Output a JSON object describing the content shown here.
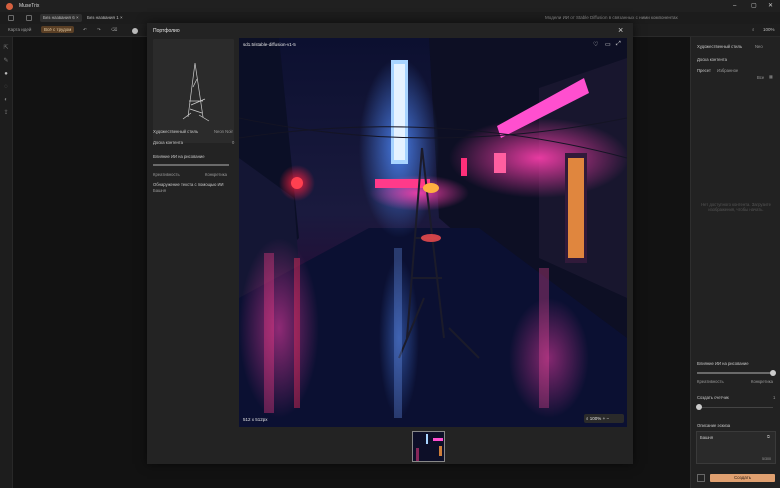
{
  "app": {
    "title": "MuseTrix"
  },
  "tabs": [
    {
      "label": "Без названия 6"
    },
    {
      "label": "Без названия 1"
    }
  ],
  "tab_right_text": "Модели ИИ от Stable Diffusion в связанных с ними компонентах",
  "toolbar": {
    "label_left": "Карта идей",
    "chip": "Всё с трудом",
    "zoom": "100%"
  },
  "modal": {
    "title": "Портфолио",
    "style_label": "Художественный стиль",
    "style_value": "Neon Noir",
    "board_label": "Доска контента",
    "board_value": "0",
    "influence_label": "Влияние ИИ на рисование",
    "slider_left": "Креативность",
    "slider_right": "Конкретика",
    "detect_label": "Обнаружение текста с помощью ИИ",
    "detect_value": "Башня",
    "image_caption": "sd1.5/stable-diffusion-v1-5",
    "image_dims": "512 x 512px",
    "image_zoom": "100%"
  },
  "right_panel": {
    "style_label": "Художественный стиль",
    "style_value": "Neo",
    "board_label": "Доска контента",
    "preset_label": "Пресет",
    "preset_value": "Избранное",
    "all_label": "Все",
    "empty_hint": "Нет доступного контента. Загрузите изображения, чтобы начать.",
    "influence_label": "Влияние ИИ на рисование",
    "slider_left": "Креативность",
    "slider_right": "Конкретика",
    "counter_label": "Создать счетчик",
    "counter_value": "1",
    "sketch_label": "Описание эскиза",
    "sketch_value": "Башня",
    "char_count": "5/300",
    "create_button": "Создать"
  },
  "colors": {
    "accent": "#d5603f",
    "create_button": "#e0a070",
    "chip_bg": "#5a3f25"
  }
}
